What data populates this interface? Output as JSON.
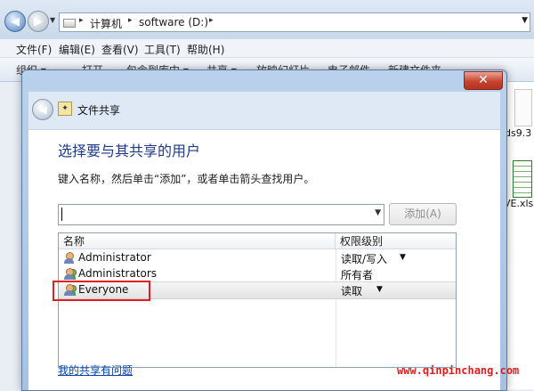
{
  "explorer": {
    "breadcrumbs": [
      "计算机",
      "software (D:)"
    ],
    "menu": [
      "文件(F)",
      "编辑(E)",
      "查看(V)",
      "工具(T)",
      "帮助(H)"
    ],
    "toolbar": [
      "组织 ▾",
      "打开",
      "包含到库中 ▾",
      "共享 ▾",
      "放映幻灯片",
      "电子邮件",
      "新建文件夹"
    ],
    "side_files": [
      "ds9.3",
      "VE.xlsx"
    ]
  },
  "dialog": {
    "title": "文件共享",
    "heading": "选择要与其共享的用户",
    "instruction": "键入名称，然后单击“添加”，或者单击箭头查找用户。",
    "name_input_value": "",
    "add_button": "添加(A)",
    "columns": {
      "name": "名称",
      "permission": "权限级别"
    },
    "rows": [
      {
        "name": "Administrator",
        "permission": "读取/写入",
        "has_dropdown": true
      },
      {
        "name": "Administrators",
        "permission": "所有者",
        "has_dropdown": false
      },
      {
        "name": "Everyone",
        "permission": "读取",
        "has_dropdown": true,
        "selected": true
      }
    ],
    "help_link": "我的共享有问题"
  },
  "watermark": "www.qinpinchang.com",
  "colors": {
    "highlight": "#e02020",
    "heading": "#1e3a8a",
    "link": "#0645ad",
    "watermark": "#e01e1e"
  }
}
